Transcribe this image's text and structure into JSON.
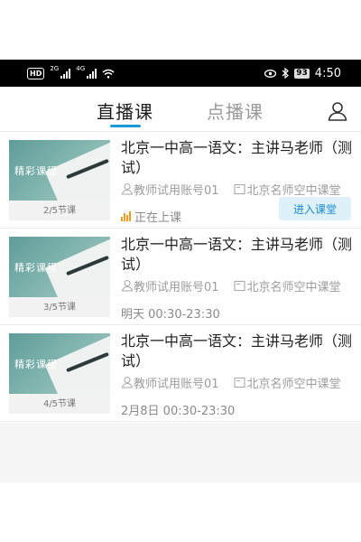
{
  "status_bar": {
    "hd_label": "HD",
    "network_labels": [
      "2G",
      "4G"
    ],
    "battery": "93",
    "time": "4:50"
  },
  "nav": {
    "tab_live": "直播课",
    "tab_vod": "点播课",
    "active_tab": "直播课",
    "accent_color": "#1a9ad6"
  },
  "courses": [
    {
      "thumb_label": "精彩课程",
      "lesson_count": "2/5节课",
      "title": "北京一中高一语文：主讲马老师（测试）",
      "teacher": "教师试用账号01",
      "school": "北京名师空中课堂",
      "status": "正在上课",
      "action_label": "进入课堂"
    },
    {
      "thumb_label": "精彩课程",
      "lesson_count": "3/5节课",
      "title": "北京一中高一语文：主讲马老师（测试）",
      "teacher": "教师试用账号01",
      "school": "北京名师空中课堂",
      "status": "明天 00:30-23:30"
    },
    {
      "thumb_label": "精彩课程",
      "lesson_count": "4/5节课",
      "title": "北京一中高一语文：主讲马老师（测试）",
      "teacher": "教师试用账号01",
      "school": "北京名师空中课堂",
      "status": "2月8日 00:30-23:30"
    }
  ]
}
